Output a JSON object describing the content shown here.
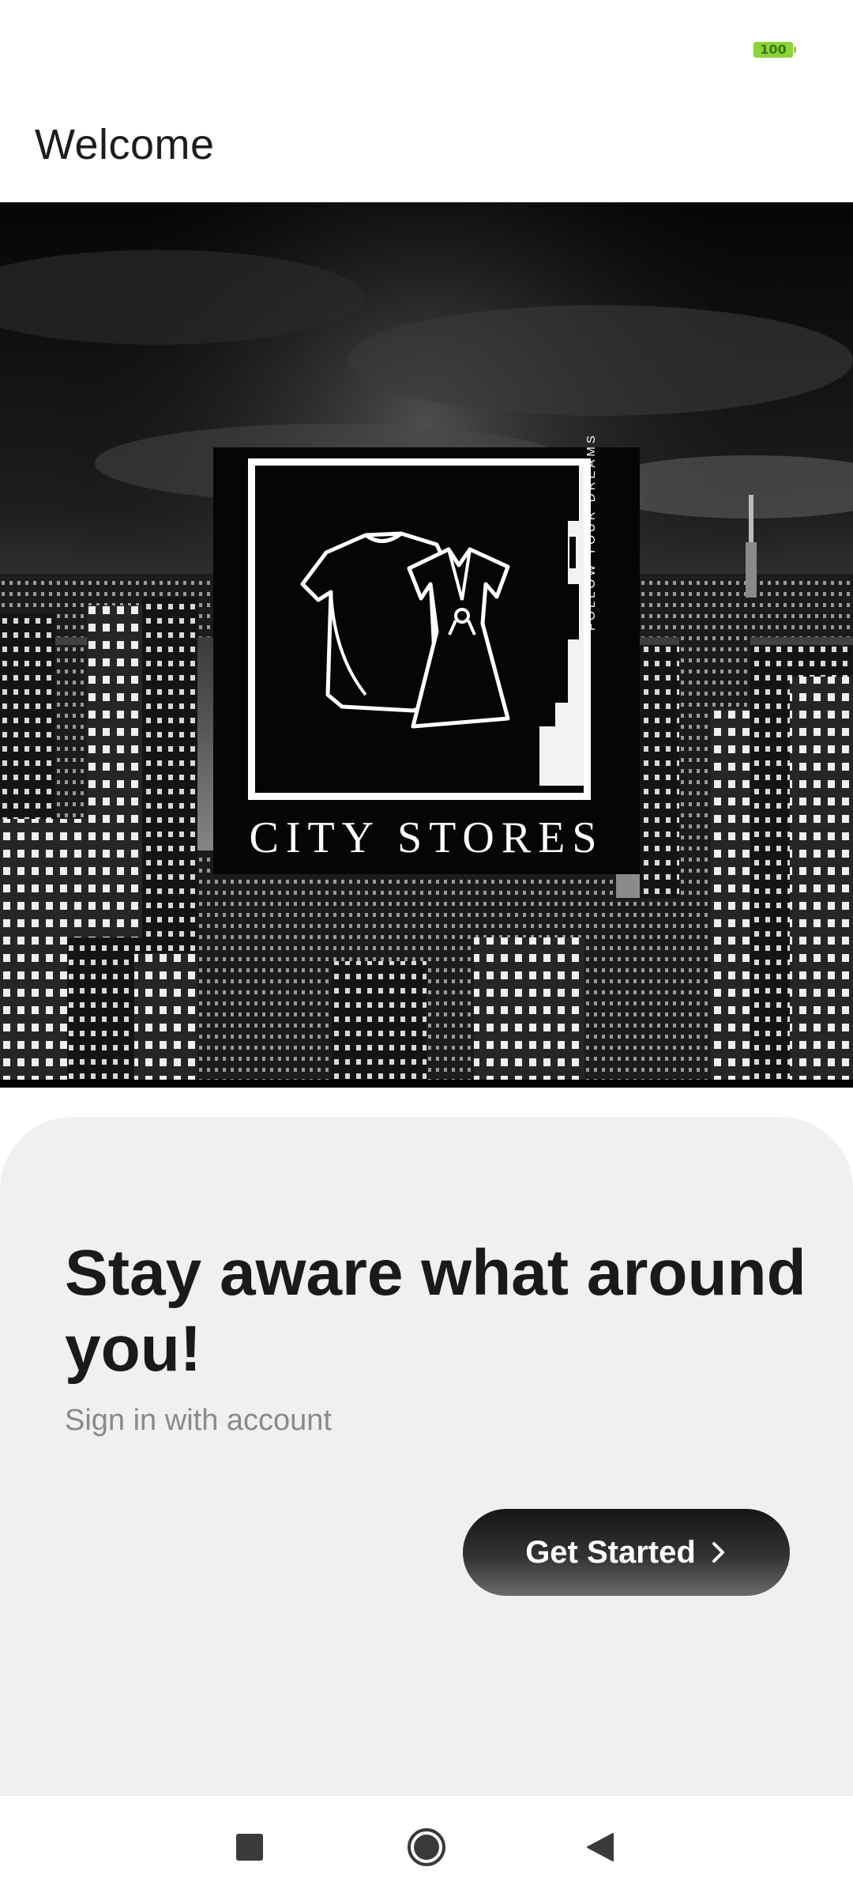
{
  "status_bar": {
    "battery_level": "100",
    "battery_color": "#8bd33a"
  },
  "app_bar": {
    "title": "Welcome"
  },
  "hero": {
    "logo": {
      "brand_name": "CITY STORES",
      "tagline": "FOLLOW YOUR DREAMS"
    }
  },
  "card": {
    "headline": "Stay aware what around you!",
    "subtitle": "Sign in with account",
    "cta": {
      "label": "Get Started",
      "icon": "chevron-right-icon"
    }
  },
  "nav_bar": {
    "items": [
      {
        "icon": "recent-apps-icon"
      },
      {
        "icon": "home-icon"
      },
      {
        "icon": "back-icon"
      }
    ]
  },
  "colors": {
    "card_background": "#f0f0f0",
    "cta_gradient_top": "#161616",
    "cta_gradient_bottom": "#6a6a6a"
  }
}
